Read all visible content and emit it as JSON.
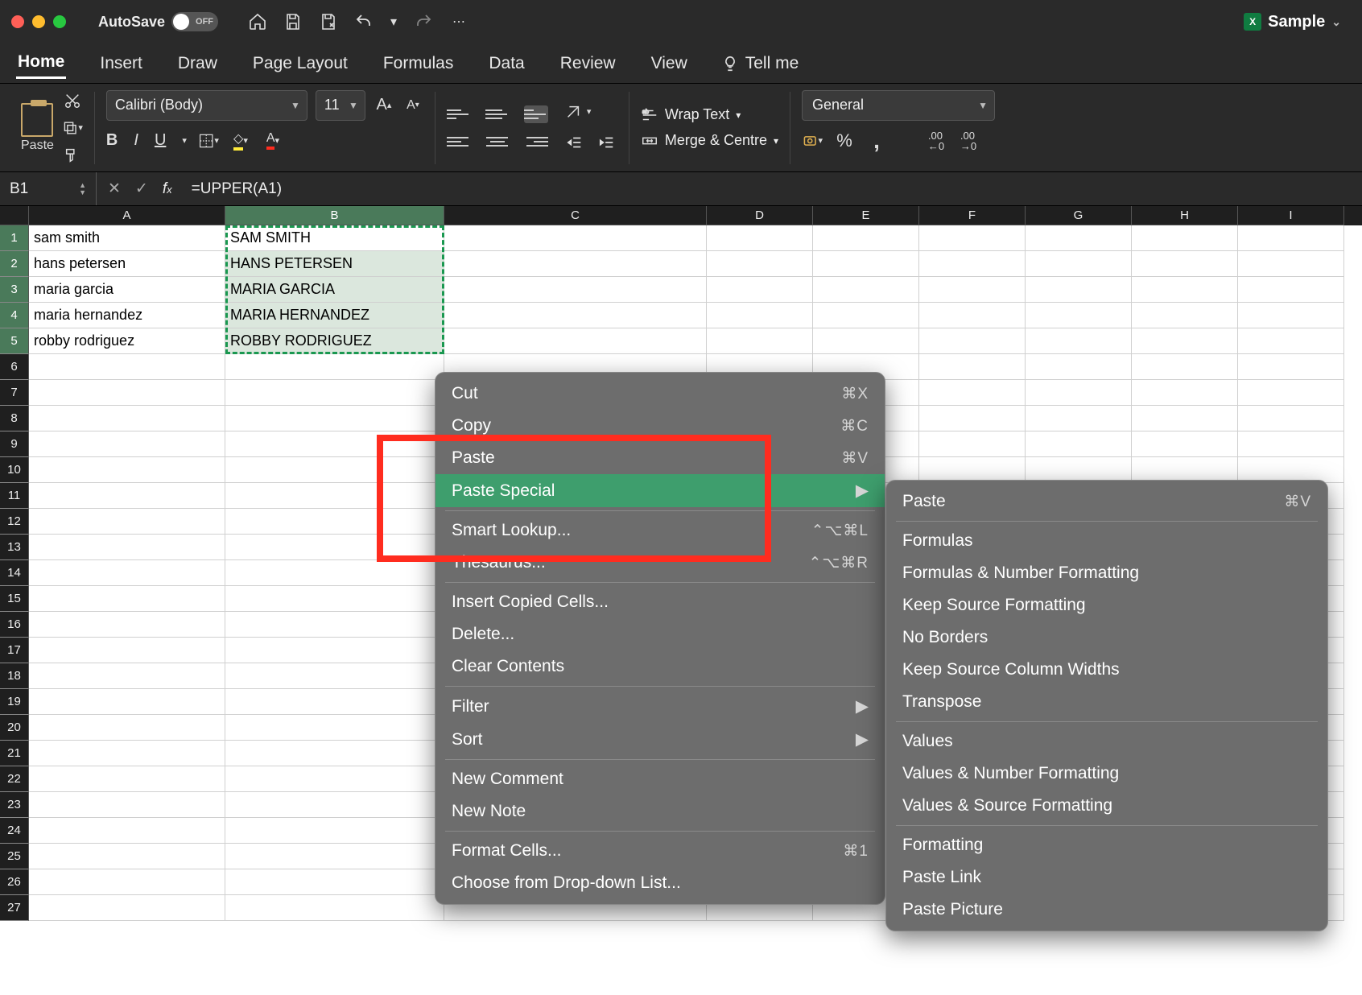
{
  "titlebar": {
    "autosave_label": "AutoSave",
    "autosave_state": "OFF",
    "doc_name": "Sample"
  },
  "tabs": [
    "Home",
    "Insert",
    "Draw",
    "Page Layout",
    "Formulas",
    "Data",
    "Review",
    "View"
  ],
  "tellme": "Tell me",
  "ribbon": {
    "paste": "Paste",
    "font_name": "Calibri (Body)",
    "font_size": "11",
    "wrap": "Wrap Text",
    "merge": "Merge & Centre",
    "number_format": "General"
  },
  "formula_bar": {
    "name_box": "B1",
    "formula": "=UPPER(A1)"
  },
  "columns": [
    "A",
    "B",
    "C",
    "D",
    "E",
    "F",
    "G",
    "H",
    "I"
  ],
  "row_count": 27,
  "cells": {
    "A": [
      "sam smith",
      "hans petersen",
      "maria garcia",
      "maria hernandez",
      "robby rodriguez"
    ],
    "B": [
      "SAM SMITH",
      "HANS PETERSEN",
      "MARIA GARCIA",
      "MARIA HERNANDEZ",
      "ROBBY RODRIGUEZ"
    ]
  },
  "context_menu": {
    "items": [
      {
        "label": "Cut",
        "shortcut": "⌘X"
      },
      {
        "label": "Copy",
        "shortcut": "⌘C"
      },
      {
        "label": "Paste",
        "shortcut": "⌘V"
      },
      {
        "label": "Paste Special",
        "submenu": true,
        "hover": true
      },
      {
        "sep": true
      },
      {
        "label": "Smart Lookup...",
        "shortcut": "⌃⌥⌘L"
      },
      {
        "label": "Thesaurus...",
        "shortcut": "⌃⌥⌘R"
      },
      {
        "sep": true
      },
      {
        "label": "Insert Copied Cells..."
      },
      {
        "label": "Delete..."
      },
      {
        "label": "Clear Contents"
      },
      {
        "sep": true
      },
      {
        "label": "Filter",
        "submenu": true
      },
      {
        "label": "Sort",
        "submenu": true
      },
      {
        "sep": true
      },
      {
        "label": "New Comment"
      },
      {
        "label": "New Note"
      },
      {
        "sep": true
      },
      {
        "label": "Format Cells...",
        "shortcut": "⌘1"
      },
      {
        "label": "Choose from Drop-down List..."
      }
    ]
  },
  "submenu": {
    "items": [
      {
        "label": "Paste",
        "shortcut": "⌘V"
      },
      {
        "sep": true
      },
      {
        "label": "Formulas"
      },
      {
        "label": "Formulas & Number Formatting"
      },
      {
        "label": "Keep Source Formatting"
      },
      {
        "label": "No Borders"
      },
      {
        "label": "Keep Source Column Widths"
      },
      {
        "label": "Transpose"
      },
      {
        "sep": true
      },
      {
        "label": "Values"
      },
      {
        "label": "Values & Number Formatting"
      },
      {
        "label": "Values & Source Formatting"
      },
      {
        "sep": true
      },
      {
        "label": "Formatting"
      },
      {
        "label": "Paste Link"
      },
      {
        "label": "Paste Picture"
      }
    ]
  }
}
